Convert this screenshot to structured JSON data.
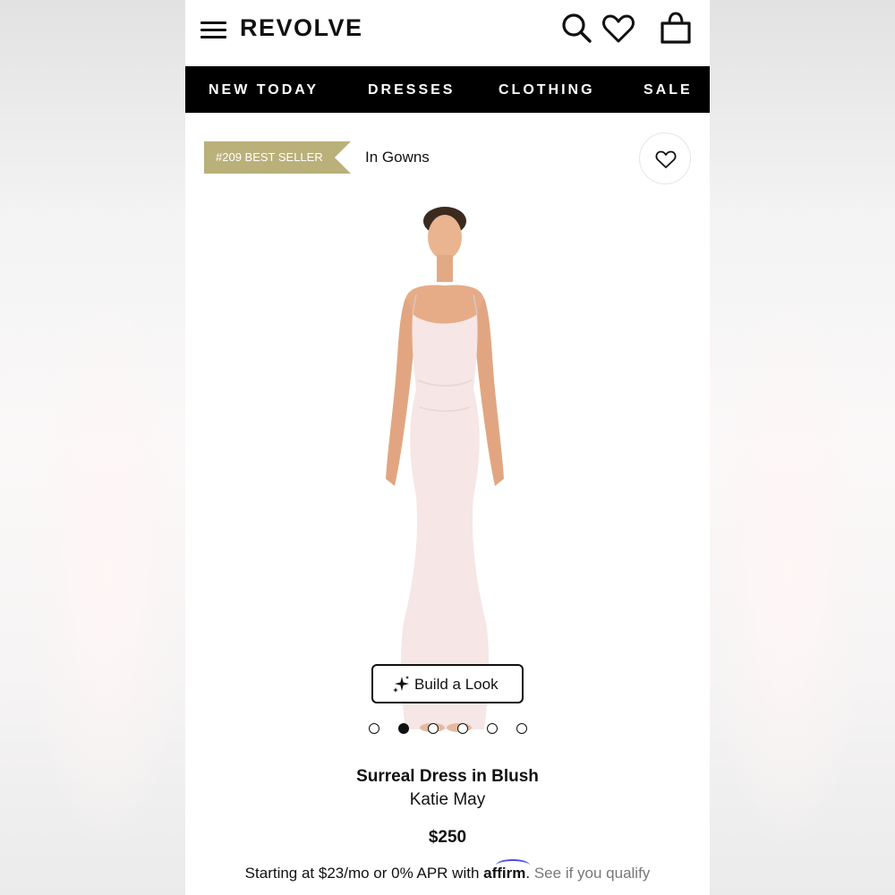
{
  "header": {
    "logo": "REVOLVE",
    "icons": [
      "menu-icon",
      "search-icon",
      "heart-icon",
      "bag-icon"
    ]
  },
  "nav": {
    "items": [
      "NEW TODAY",
      "DRESSES",
      "CLOTHING",
      "SALE"
    ]
  },
  "badge": {
    "label": "#209 BEST SELLER",
    "color": "#b9b07a"
  },
  "category": "In Gowns",
  "build_look": {
    "label": "Build a Look",
    "icon": "sparkle-icon"
  },
  "carousel": {
    "total": 6,
    "active_index": 1
  },
  "product": {
    "name": "Surreal Dress in Blush",
    "brand": "Katie May",
    "price": "$250"
  },
  "financing": {
    "prefix": "Starting at $23/mo or 0% APR with",
    "provider": "affirm",
    "suffix": ". ",
    "link": "See if you qualify"
  },
  "colors": {
    "nav_bg": "#000000",
    "badge": "#b9b07a",
    "dress": "#f6e6e6",
    "affirm_arc": "#4a4af4"
  }
}
